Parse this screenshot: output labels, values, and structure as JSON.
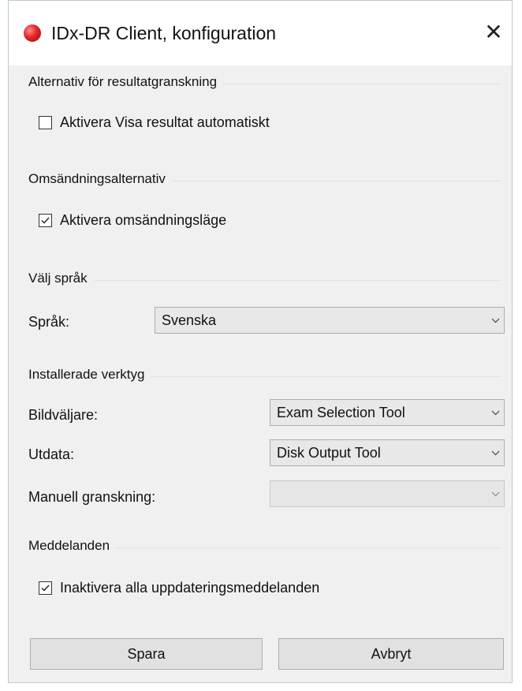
{
  "window": {
    "title": "IDx-DR Client, konfiguration",
    "close_glyph": "✕"
  },
  "result_review": {
    "header": "Alternativ för resultatgranskning",
    "checkbox_label": "Aktivera Visa resultat automatiskt",
    "checked": false
  },
  "resend": {
    "header": "Omsändningsalternativ",
    "checkbox_label": "Aktivera omsändningsläge",
    "checked": true
  },
  "language": {
    "header": "Välj språk",
    "label": "Språk:",
    "value": "Svenska"
  },
  "tools": {
    "header": "Installerade verktyg",
    "image_selector_label": "Bildväljare:",
    "image_selector_value": "Exam Selection Tool",
    "output_label": "Utdata:",
    "output_value": "Disk Output Tool",
    "manual_review_label": "Manuell granskning:",
    "manual_review_value": ""
  },
  "messages": {
    "header": "Meddelanden",
    "checkbox_label": "Inaktivera alla uppdateringsmeddelanden",
    "checked": true
  },
  "buttons": {
    "save": "Spara",
    "cancel": "Avbryt"
  },
  "icons": {
    "app": "red-circle-app-icon",
    "close": "close-icon",
    "checkmark": "checkmark-icon",
    "dropdown": "chevron-down-icon"
  }
}
